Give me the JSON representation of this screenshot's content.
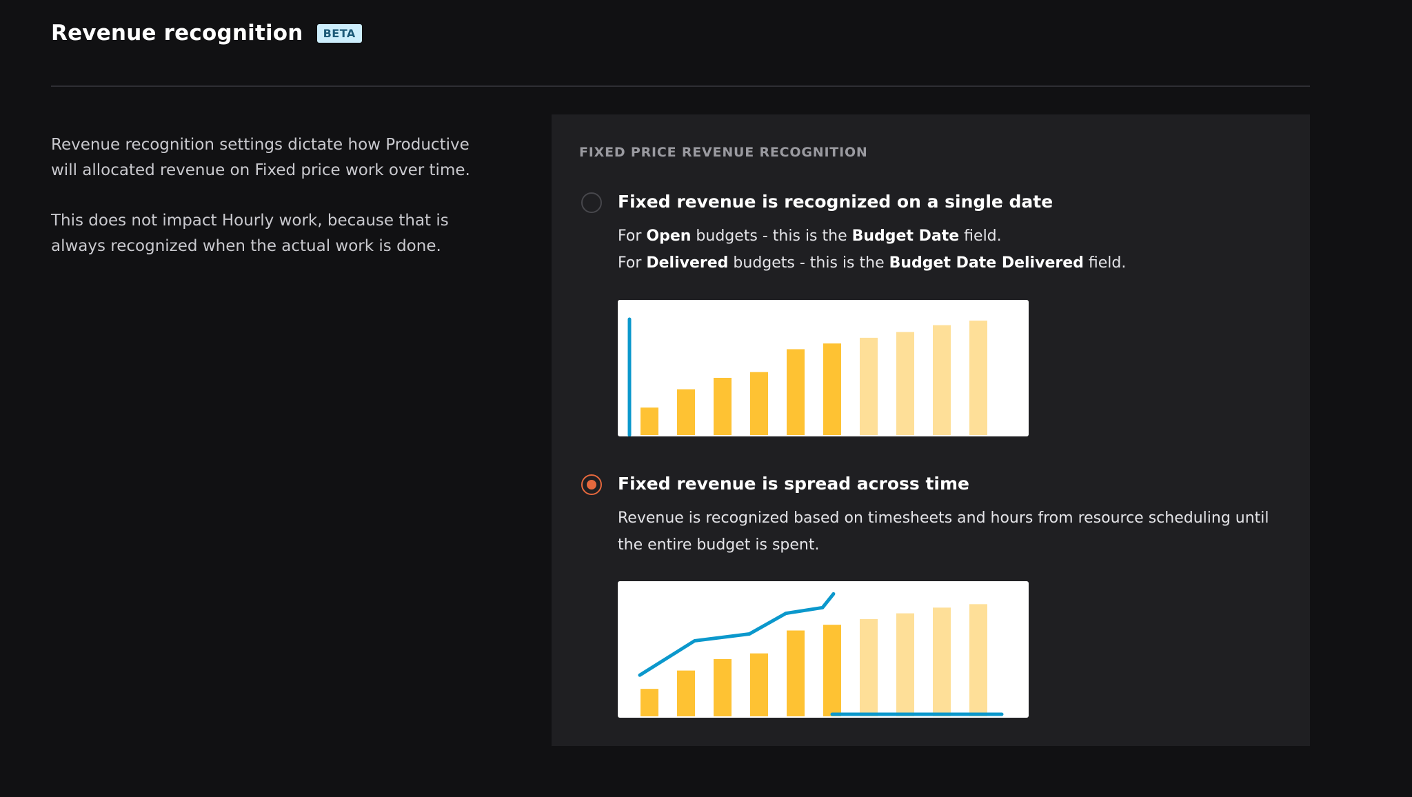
{
  "header": {
    "title": "Revenue recognition",
    "badge": "BETA"
  },
  "description": {
    "paragraph_1": "Revenue recognition settings dictate how Productive will allocated revenue on Fixed price work over time.",
    "paragraph_2": "This does not impact Hourly work, because that is always recognized when the actual work is done."
  },
  "panel": {
    "section_label": "FIXED PRICE REVENUE RECOGNITION",
    "options": [
      {
        "title": "Fixed revenue is recognized on a single date",
        "selected": false,
        "desc_line_1": {
          "prefix": "For ",
          "bold_1": "Open",
          "middle": " budgets - this is the ",
          "bold_2": "Budget Date",
          "suffix": " field."
        },
        "desc_line_2": {
          "prefix": "For ",
          "bold_1": "Delivered",
          "middle": " budgets - this is the ",
          "bold_2": "Budget Date Delivered",
          "suffix": " field."
        }
      },
      {
        "title": "Fixed revenue is spread across time",
        "selected": true,
        "desc": "Revenue is recognized based on timesheets and hours from resource scheduling until the entire budget is spent."
      }
    ]
  },
  "colors": {
    "accent_radio": "#e5683d",
    "bar_actual": "#fec233",
    "bar_future": "#fedf98",
    "line": "#0b98cc"
  },
  "chart_data": [
    {
      "type": "bar",
      "categories": [
        "1",
        "2",
        "3",
        "4",
        "5",
        "6",
        "7",
        "8",
        "9",
        "10"
      ],
      "series": [
        {
          "values": [
            24,
            40,
            50,
            55,
            75,
            80,
            85,
            90,
            96,
            100
          ]
        }
      ],
      "bar_states": [
        "actual",
        "actual",
        "actual",
        "actual",
        "actual",
        "actual",
        "future",
        "future",
        "future",
        "future"
      ],
      "marker": {
        "type": "vertical-line",
        "at_category": "1",
        "value": 100
      },
      "ylim": [
        0,
        100
      ]
    },
    {
      "type": "bar",
      "categories": [
        "1",
        "2",
        "3",
        "4",
        "5",
        "6",
        "7",
        "8",
        "9",
        "10"
      ],
      "series": [
        {
          "values": [
            24,
            40,
            50,
            55,
            75,
            80,
            85,
            90,
            95,
            98
          ]
        }
      ],
      "bar_states": [
        "actual",
        "actual",
        "actual",
        "actual",
        "actual",
        "actual",
        "future",
        "future",
        "future",
        "future"
      ],
      "line": {
        "type": "line",
        "values": [
          36,
          66,
          72,
          90,
          95,
          107
        ],
        "categories": [
          "1",
          "2.5",
          "4",
          "5",
          "6",
          "6.3"
        ]
      },
      "baseline": {
        "from_category": "6",
        "to_category": "10"
      },
      "ylim": [
        0,
        100
      ]
    }
  ]
}
